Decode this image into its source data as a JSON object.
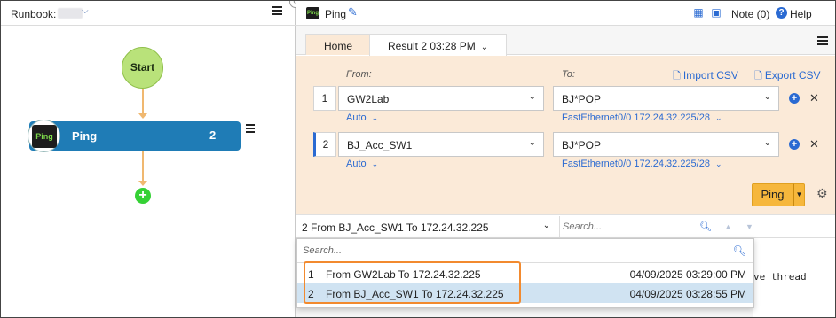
{
  "left_panel": {
    "runbook_label": "Runbook:",
    "flow": {
      "start_label": "Start",
      "node": {
        "icon_text": "Ping",
        "title": "Ping",
        "count": "2"
      }
    }
  },
  "right_panel": {
    "header": {
      "icon_text": "Ping",
      "title": "Ping",
      "note_label": "Note (0)",
      "help_label": "Help"
    },
    "tabs": [
      {
        "label": "Home"
      },
      {
        "label": "Result 2  03:28 PM"
      }
    ],
    "form": {
      "from_label": "From:",
      "to_label": "To:",
      "import_csv": "Import CSV",
      "export_csv": "Export CSV",
      "rows": [
        {
          "num": "1",
          "from": "GW2Lab",
          "from_sub": "Auto",
          "to": "BJ*POP",
          "to_sub": "FastEthernet0/0 172.24.32.225/28"
        },
        {
          "num": "2",
          "from": "BJ_Acc_SW1",
          "from_sub": "Auto",
          "to": "BJ*POP",
          "to_sub": "FastEthernet0/0 172.24.32.225/28"
        }
      ]
    },
    "ping_button": "Ping",
    "result_selector": "2 From BJ_Acc_SW1 To 172.24.32.225",
    "result_search_placeholder": "Search...",
    "output_text": "ve thread"
  },
  "dropdown": {
    "search_placeholder": "Search...",
    "items": [
      {
        "num": "1",
        "label": "From  GW2Lab  To  172.24.32.225",
        "time": "04/09/2025 03:29:00 PM"
      },
      {
        "num": "2",
        "label": "From  BJ_Acc_SW1  To  172.24.32.225",
        "time": "04/09/2025 03:28:55 PM"
      }
    ],
    "selected_index": 1
  },
  "colors": {
    "node_blue": "#1f7cb6",
    "start_green": "#b9e27a",
    "form_bg": "#fbead8",
    "ping_orange": "#f6b73c",
    "highlight_orange": "#f28a2f",
    "link_blue": "#2a6ad2"
  }
}
